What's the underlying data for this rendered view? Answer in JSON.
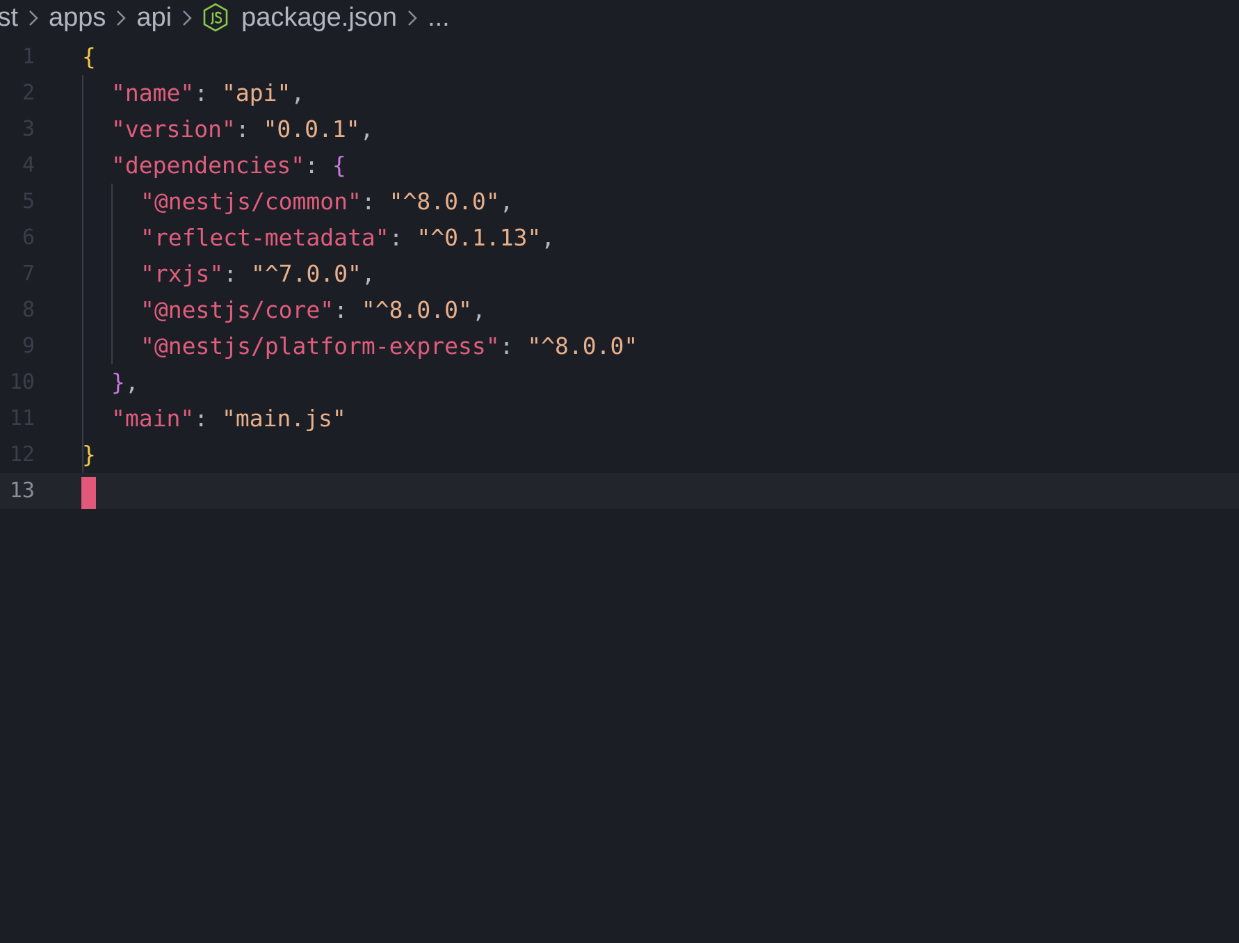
{
  "breadcrumb": {
    "segments": [
      "ist",
      "apps",
      "api",
      "package.json",
      "..."
    ],
    "file_icon": "nodejs-icon"
  },
  "editor": {
    "line_numbers": [
      "1",
      "2",
      "3",
      "4",
      "5",
      "6",
      "7",
      "8",
      "9",
      "10",
      "11",
      "12",
      "13"
    ],
    "current_line": "13",
    "lines": {
      "l1": {
        "brace": "{"
      },
      "l2": {
        "key": "\"name\"",
        "sep": ": ",
        "value": "\"api\"",
        "comma": ","
      },
      "l3": {
        "key": "\"version\"",
        "sep": ": ",
        "value": "\"0.0.1\"",
        "comma": ","
      },
      "l4": {
        "key": "\"dependencies\"",
        "sep": ": ",
        "brace": "{"
      },
      "l5": {
        "key": "\"@nestjs/common\"",
        "sep": ": ",
        "value": "\"^8.0.0\"",
        "comma": ","
      },
      "l6": {
        "key": "\"reflect-metadata\"",
        "sep": ": ",
        "value": "\"^0.1.13\"",
        "comma": ","
      },
      "l7": {
        "key": "\"rxjs\"",
        "sep": ": ",
        "value": "\"^7.0.0\"",
        "comma": ","
      },
      "l8": {
        "key": "\"@nestjs/core\"",
        "sep": ": ",
        "value": "\"^8.0.0\"",
        "comma": ","
      },
      "l9": {
        "key": "\"@nestjs/platform-express\"",
        "sep": ": ",
        "value": "\"^8.0.0\""
      },
      "l10": {
        "brace": "}",
        "comma": ","
      },
      "l11": {
        "key": "\"main\"",
        "sep": ": ",
        "value": "\"main.js\""
      },
      "l12": {
        "brace": "}"
      }
    }
  },
  "colors": {
    "background": "#1b1e25",
    "current_line": "#23252c",
    "key": "#e05d7c",
    "string": "#e8b08a",
    "outer_brace": "#f2c94c",
    "inner_brace": "#c678dd",
    "cursor": "#e2587a",
    "nodejs_icon": "#8cc84b"
  }
}
